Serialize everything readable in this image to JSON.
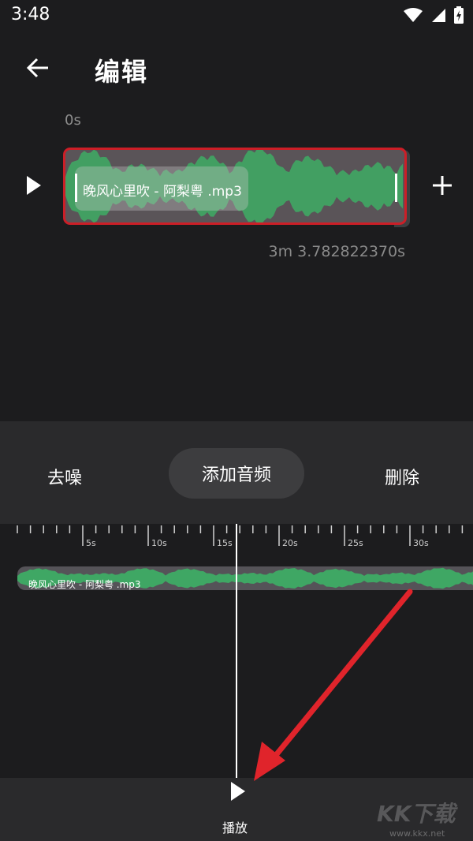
{
  "status_bar": {
    "time": "3:48",
    "icons": [
      "wifi-icon",
      "signal-icon",
      "battery-icon"
    ]
  },
  "header": {
    "title": "编辑",
    "back_icon": "back-arrow-icon"
  },
  "editor": {
    "start_time": "0s",
    "clip_name": "晚风心里吹 - 阿梨粤 .mp3",
    "duration": "3m 3.782822370s",
    "play_icon": "play-icon",
    "add_icon": "plus-icon"
  },
  "actions": {
    "denoise": "去噪",
    "add_audio": "添加音频",
    "delete": "删除"
  },
  "timeline": {
    "ticks": [
      "5s",
      "10s",
      "15s",
      "20s",
      "25s",
      "30s"
    ],
    "track_name": "晚风心里吹 - 阿梨粤 .mp3"
  },
  "bottom": {
    "play_label": "播放",
    "play_icon": "play-icon"
  },
  "watermark": {
    "text": "KK下载",
    "sub": "www.kkx.net"
  },
  "colors": {
    "waveform": "#3fa764",
    "clip_border": "#cc1e27",
    "arrow": "#e0242b",
    "background": "#1c1c1e",
    "panel": "#2a2a2c"
  }
}
